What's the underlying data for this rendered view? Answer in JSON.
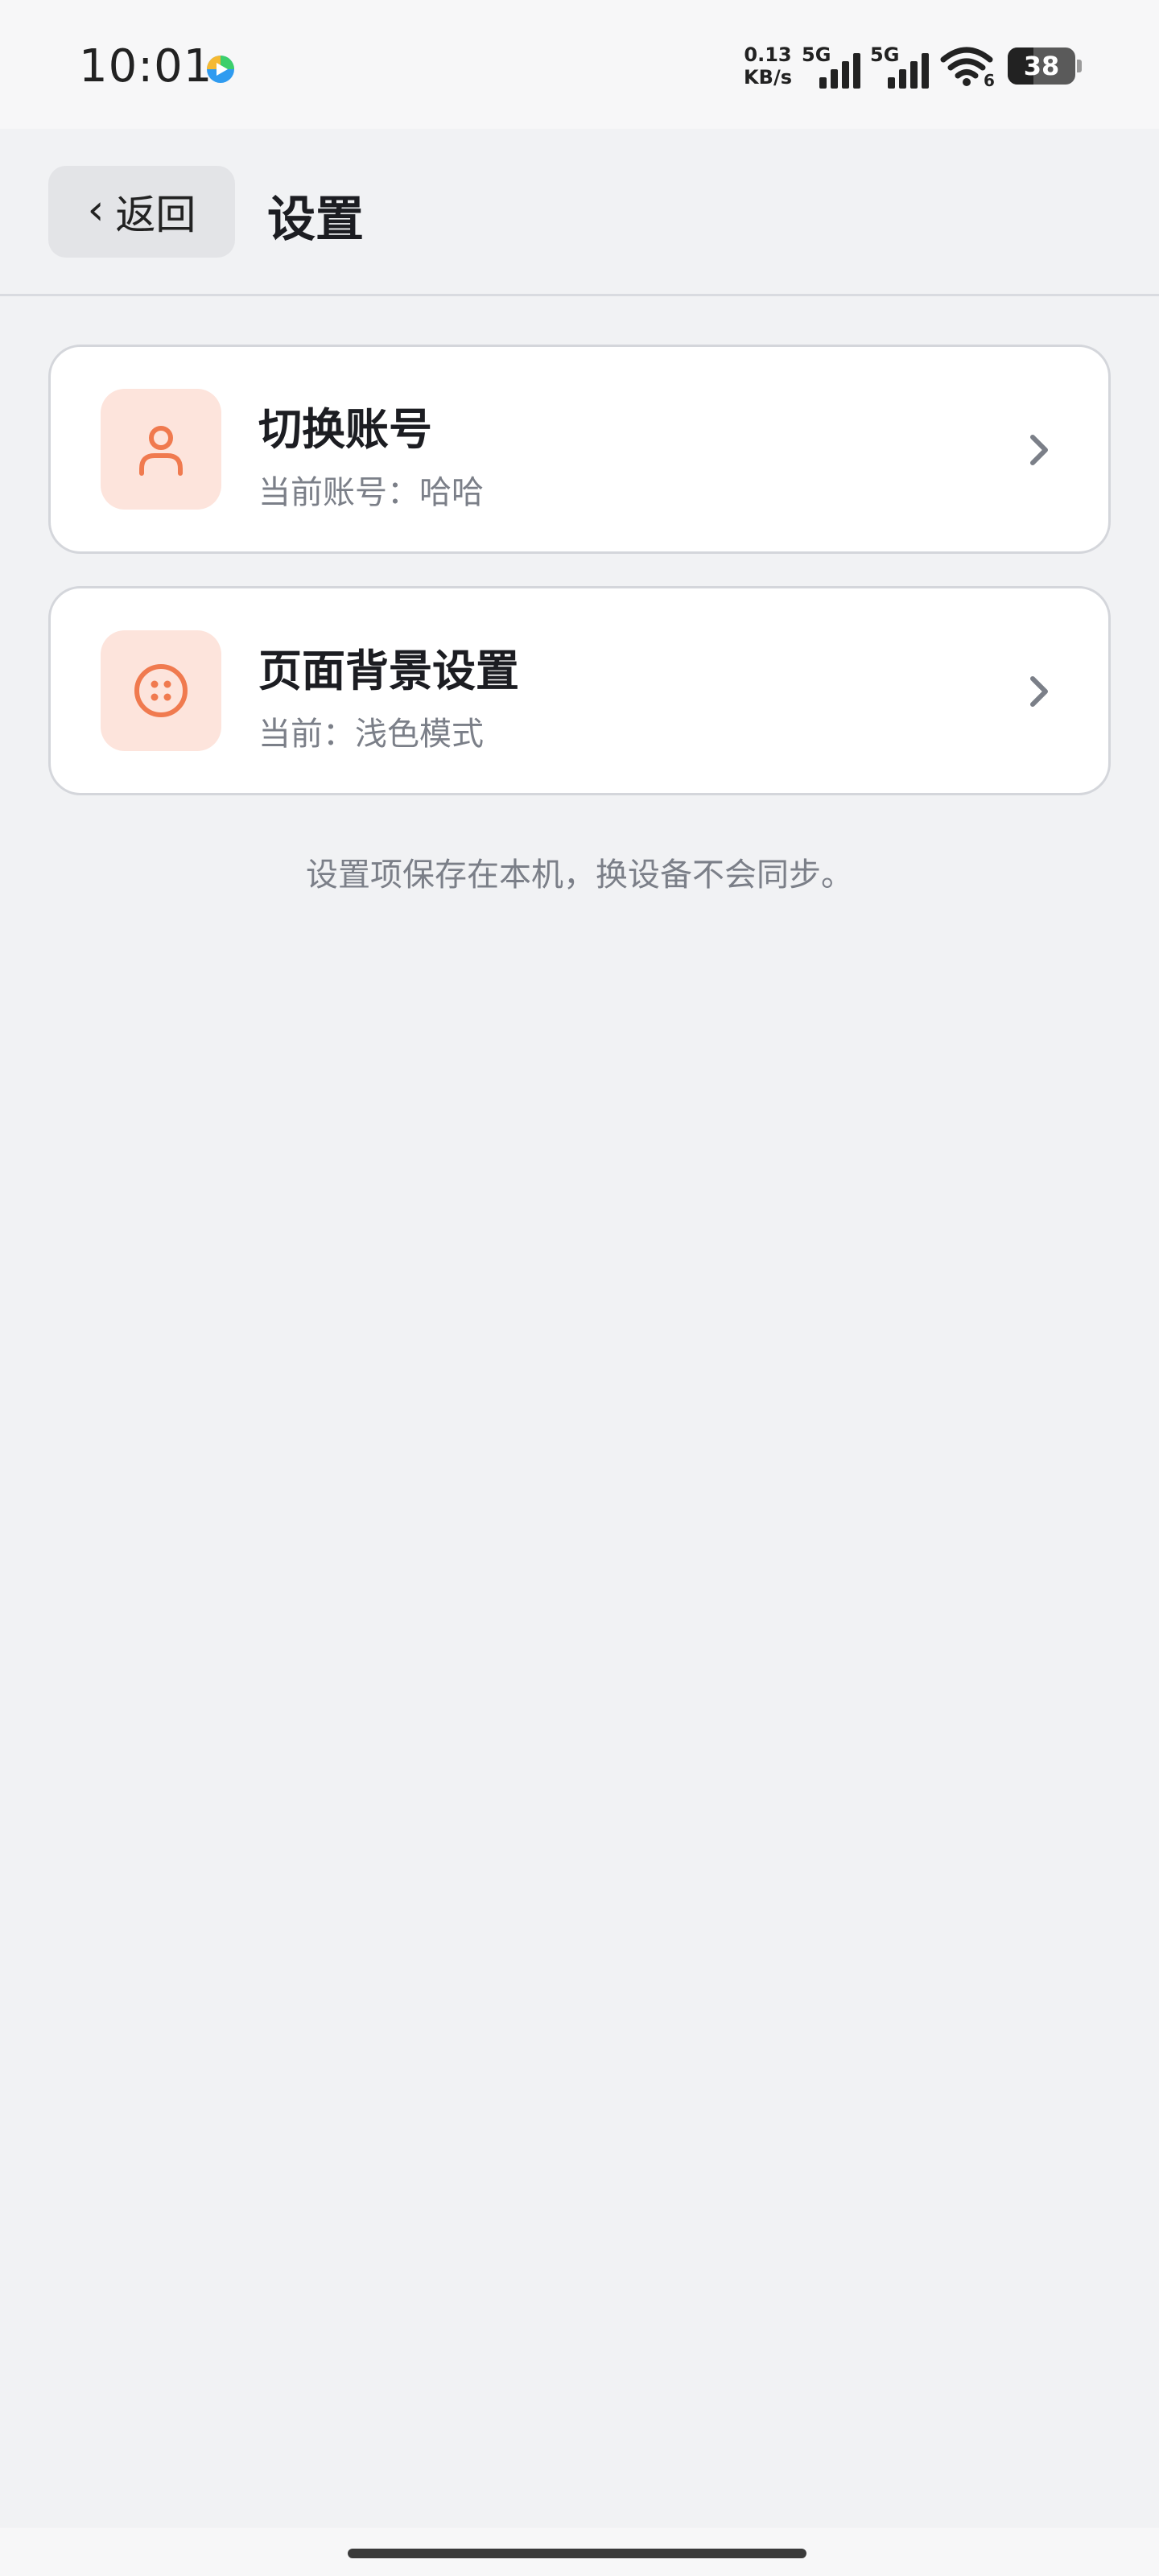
{
  "status_bar": {
    "time": "10:01",
    "net_speed_value": "0.13",
    "net_speed_unit": "KB/s",
    "signal_1_label": "5G",
    "signal_2_label": "5G",
    "wifi_badge": "6",
    "battery_level": "38",
    "app_icon": "play-app-icon"
  },
  "header": {
    "back_label": "返回",
    "back_icon": "chevron-left-icon",
    "title": "设置"
  },
  "settings": {
    "items": [
      {
        "title": "切换账号",
        "subtitle": "当前账号：哈哈",
        "icon": "user-icon"
      },
      {
        "title": "页面背景设置",
        "subtitle": "当前：浅色模式",
        "icon": "palette-icon"
      }
    ]
  },
  "footer_note": "设置项保存在本机，换设备不会同步。",
  "colors": {
    "accent": "#f07a4f",
    "icon_bg": "#fde4dc",
    "page_bg": "#f1f2f4",
    "card_bg": "#ffffff",
    "muted_text": "#7b7f88"
  }
}
